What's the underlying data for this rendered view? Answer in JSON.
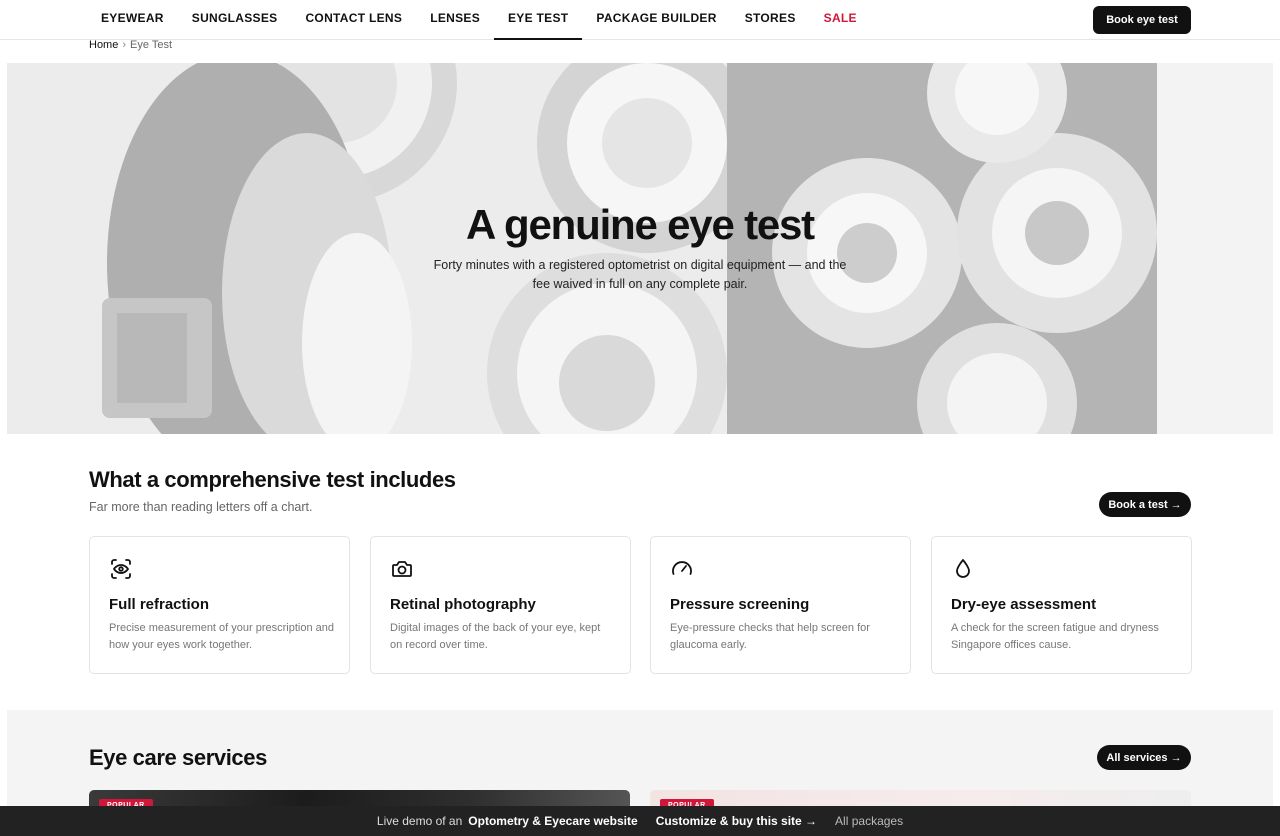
{
  "nav": {
    "items": [
      {
        "label": "EYEWEAR"
      },
      {
        "label": "SUNGLASSES"
      },
      {
        "label": "CONTACT LENS"
      },
      {
        "label": "LENSES"
      },
      {
        "label": "EYE TEST"
      },
      {
        "label": "PACKAGE BUILDER"
      },
      {
        "label": "STORES"
      },
      {
        "label": "SALE"
      }
    ],
    "active": "EYE TEST",
    "cta_label": "Book eye test"
  },
  "breadcrumb": {
    "home": "Home",
    "separator": "›",
    "current": "Eye Test"
  },
  "hero": {
    "title": "A genuine eye test",
    "subtitle": "Forty minutes with a registered optometrist on digital equipment — and the fee waived in full on any complete pair."
  },
  "includes": {
    "title": "What a comprehensive test includes",
    "subtitle": "Far more than reading letters off a chart.",
    "cta_label": "Book a test →",
    "cards": [
      {
        "icon": "eye-scan-icon",
        "title": "Full refraction",
        "desc": "Precise measurement of your prescription and how your eyes work together."
      },
      {
        "icon": "camera-icon",
        "title": "Retinal photography",
        "desc": "Digital images of the back of your eye, kept on record over time."
      },
      {
        "icon": "gauge-icon",
        "title": "Pressure screening",
        "desc": "Eye-pressure checks that help screen for glaucoma early."
      },
      {
        "icon": "droplet-icon",
        "title": "Dry-eye assessment",
        "desc": "A check for the screen fatigue and dryness Singapore offices cause."
      }
    ]
  },
  "services": {
    "title": "Eye care services",
    "cta_label": "All services →",
    "cards": [
      {
        "badge": "POPULAR"
      },
      {
        "badge": "POPULAR"
      }
    ]
  },
  "demo_bar": {
    "prefix": "Live demo of an",
    "site_type": "Optometry & Eyecare website",
    "customize_label": "Customize & buy this site →",
    "packages_label": "All packages"
  },
  "colors": {
    "accent": "#111111",
    "sale": "#d0173a",
    "card_border": "#e3e3e3",
    "demo_bar": "#222222"
  }
}
